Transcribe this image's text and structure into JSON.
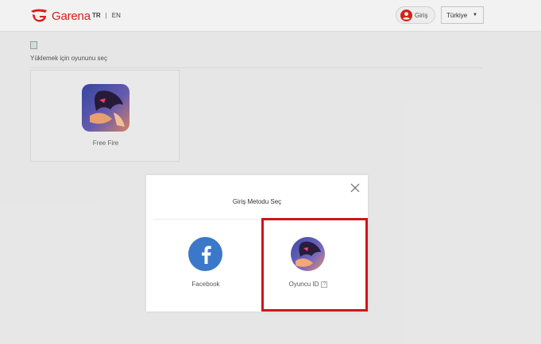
{
  "header": {
    "brand": "Garena",
    "lang_tr": "TR",
    "lang_sep": "|",
    "lang_en": "EN",
    "login_label": "Giriş",
    "region_label": "Türkiye",
    "region_caret": "▼"
  },
  "page": {
    "select_game_label": "Yüklemek için oyununu seç",
    "games": [
      {
        "name": "Free Fire"
      }
    ]
  },
  "modal": {
    "title": "Giriş Metodu Seç",
    "options": [
      {
        "label": "Facebook",
        "icon": "facebook-icon"
      },
      {
        "label": "Oyuncu ID",
        "icon": "player-avatar",
        "help": "?"
      }
    ]
  },
  "colors": {
    "brand_red": "#e2231a",
    "facebook_blue": "#3b78c9",
    "highlight_red": "#d0141b"
  }
}
